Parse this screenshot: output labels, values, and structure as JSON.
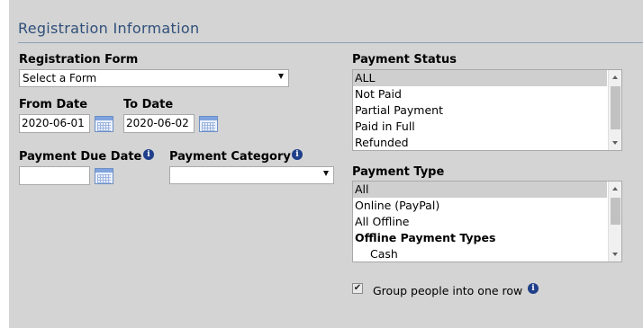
{
  "section": {
    "title": "Registration Information"
  },
  "registration_form": {
    "label": "Registration Form",
    "selected": "Select a Form"
  },
  "from_date": {
    "label": "From Date",
    "value": "2020-06-01"
  },
  "to_date": {
    "label": "To Date",
    "value": "2020-06-02"
  },
  "payment_due_date": {
    "label": "Payment Due Date",
    "value": ""
  },
  "payment_category": {
    "label": "Payment Category",
    "selected": ""
  },
  "payment_status": {
    "label": "Payment Status",
    "options": [
      "ALL",
      "Not Paid",
      "Partial Payment",
      "Paid in Full",
      "Refunded"
    ],
    "selected": "ALL"
  },
  "payment_type": {
    "label": "Payment Type",
    "options": [
      "All",
      "Online (PayPal)",
      "All Offline",
      "Offline Payment Types",
      "Cash"
    ],
    "selected": "All"
  },
  "group_people": {
    "label": "Group people into one row",
    "checked": true
  },
  "info_glyph": "i",
  "check_glyph": "✔",
  "colors": {
    "background": "#d4d4d4",
    "title": "#2f4f7a",
    "info_icon": "#1f3f8a",
    "selected_option": "#cfcfcf"
  }
}
